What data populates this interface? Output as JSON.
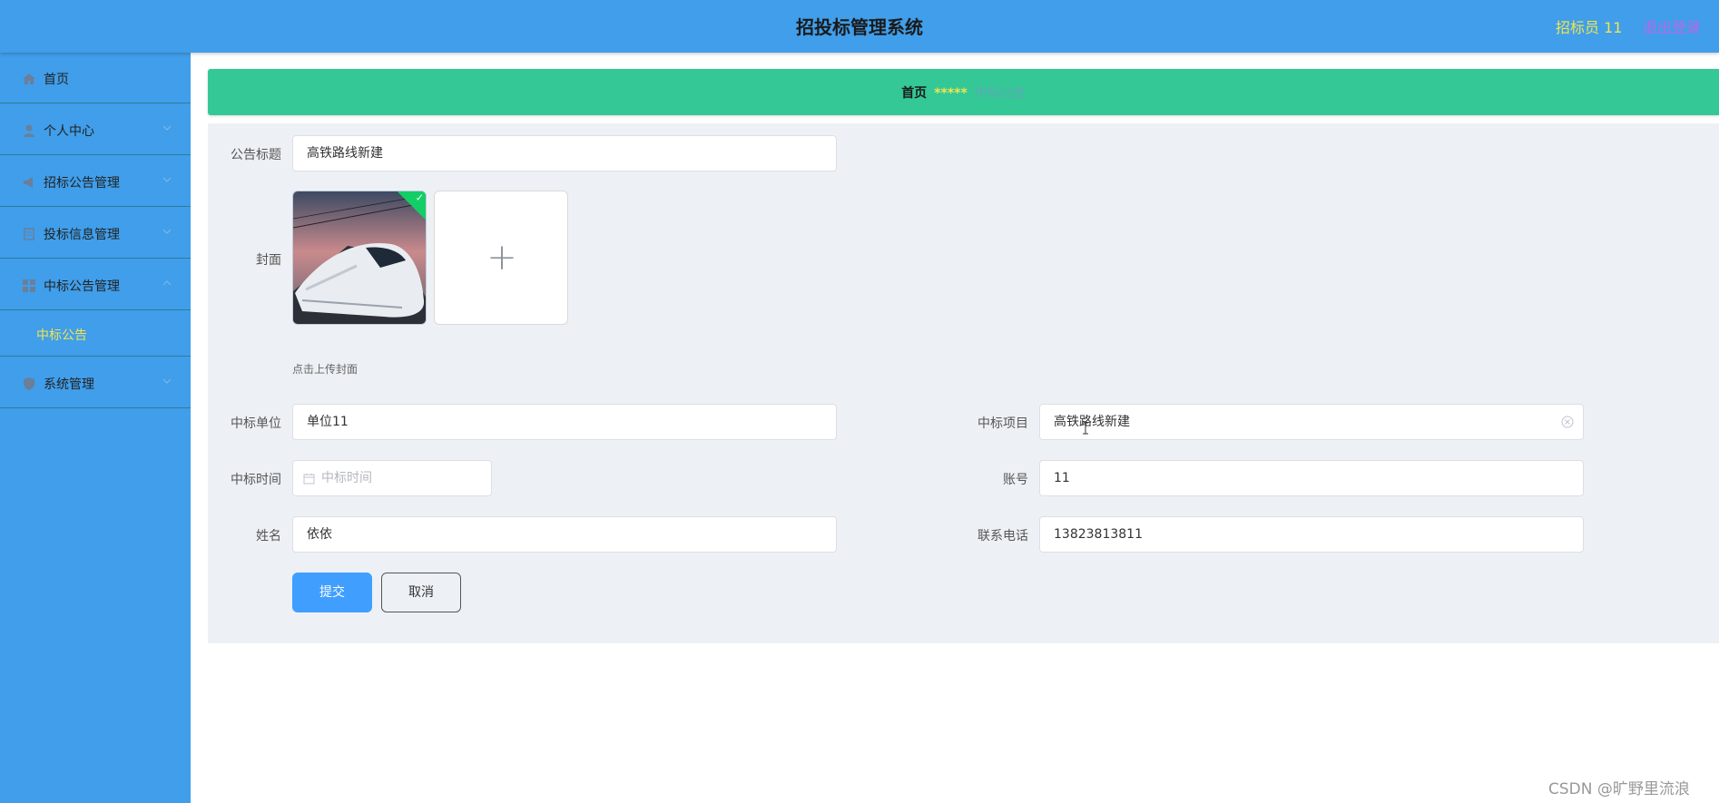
{
  "header": {
    "title": "招投标管理系统",
    "user_label": "招标员 11",
    "logout_label": "退出登录"
  },
  "sidebar": {
    "items": [
      {
        "label": "首页",
        "icon": "home-icon"
      },
      {
        "label": "个人中心",
        "icon": "user-icon"
      },
      {
        "label": "招标公告管理",
        "icon": "megaphone-icon"
      },
      {
        "label": "投标信息管理",
        "icon": "document-icon"
      },
      {
        "label": "中标公告管理",
        "icon": "grid-icon",
        "expanded": true,
        "children": [
          {
            "label": "中标公告",
            "active": true
          }
        ]
      },
      {
        "label": "系统管理",
        "icon": "shield-icon"
      }
    ]
  },
  "breadcrumb": {
    "home": "首页",
    "separator": "*****",
    "current": "中标公告"
  },
  "form": {
    "title_label": "公告标题",
    "title_value": "高铁路线新建",
    "cover_label": "封面",
    "cover_tip": "点击上传封面",
    "company_label": "中标单位",
    "company_value": "单位11",
    "project_label": "中标项目",
    "project_value": "高铁路线新建",
    "time_label": "中标时间",
    "time_placeholder": "中标时间",
    "account_label": "账号",
    "account_value": "11",
    "name_label": "姓名",
    "name_value": "依依",
    "phone_label": "联系电话",
    "phone_value": "13823813811",
    "submit_label": "提交",
    "cancel_label": "取消"
  },
  "watermark": "CSDN @旷野里流浪",
  "colors": {
    "header_bg": "#409eea",
    "sidebar_bg": "#409eea",
    "breadcrumb_bg": "#33c896",
    "accent_yellow": "#f0e54f",
    "logout_purple": "#b968e6",
    "primary_button": "#409eff"
  }
}
